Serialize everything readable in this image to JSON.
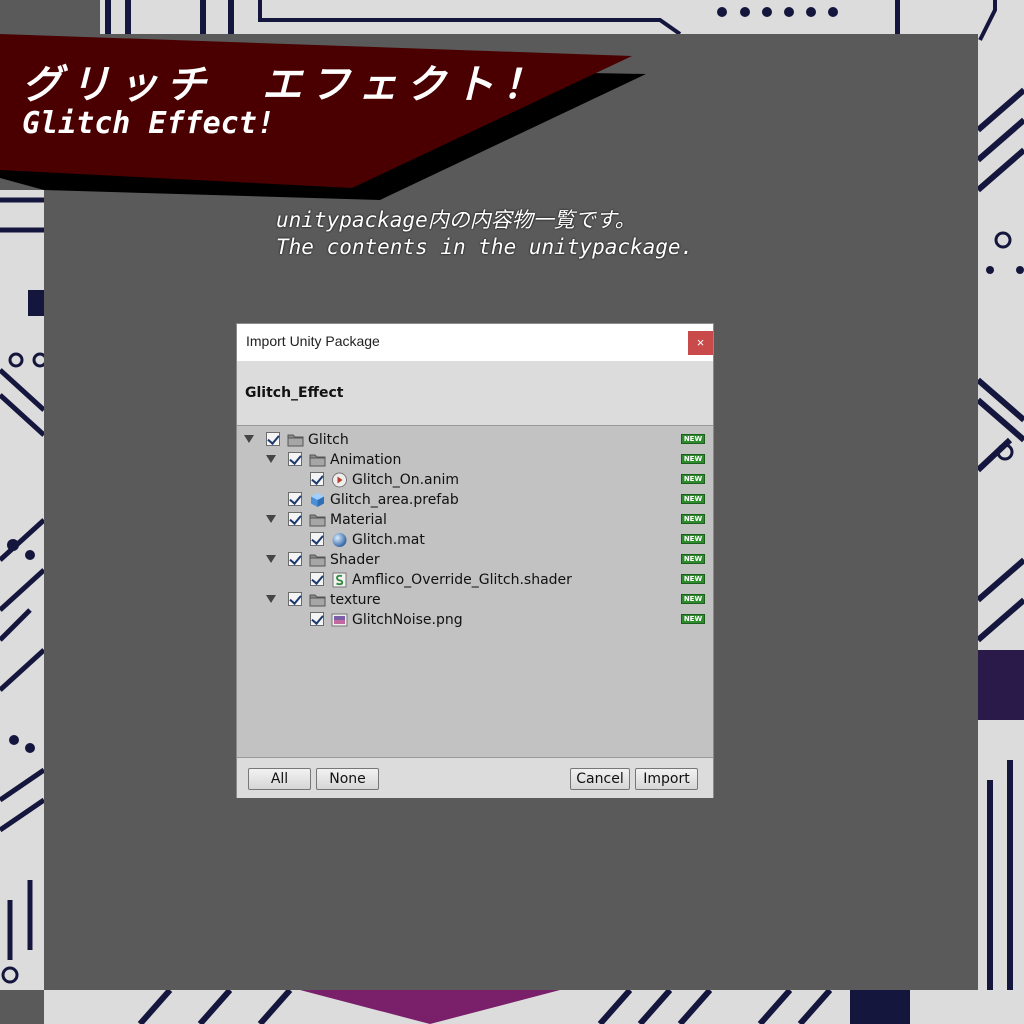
{
  "banner": {
    "title_jp": "グリッチ　エフェクト！",
    "title_en": "Glitch Effect!",
    "subtitle_jp": "unitypackage内の内容物一覧です。",
    "subtitle_en": "The contents in the unitypackage."
  },
  "dialog": {
    "window_title": "Import Unity Package",
    "close_label": "×",
    "package_name": "Glitch_Effect",
    "new_badge": "NEW",
    "items": [
      {
        "name": "Glitch",
        "type": "folder-icon",
        "checked": true,
        "expanded": true
      },
      {
        "name": "Animation",
        "type": "folder-icon",
        "checked": true,
        "expanded": true
      },
      {
        "name": "Glitch_On.anim",
        "type": "animation-icon",
        "checked": true
      },
      {
        "name": "Glitch_area.prefab",
        "type": "prefab-icon",
        "checked": true
      },
      {
        "name": "Material",
        "type": "folder-icon",
        "checked": true,
        "expanded": true
      },
      {
        "name": "Glitch.mat",
        "type": "material-icon",
        "checked": true
      },
      {
        "name": "Shader",
        "type": "folder-icon",
        "checked": true,
        "expanded": true
      },
      {
        "name": "Amflico_Override_Glitch.shader",
        "type": "shader-icon",
        "checked": true
      },
      {
        "name": "texture",
        "type": "folder-icon",
        "checked": true,
        "expanded": true
      },
      {
        "name": "GlitchNoise.png",
        "type": "texture-icon",
        "checked": true
      }
    ],
    "buttons": {
      "all": "All",
      "none": "None",
      "cancel": "Cancel",
      "import": "Import"
    }
  },
  "colors": {
    "banner_red": "#4a0000",
    "background": "#5a5a5a",
    "circuit_navy": "#14143c",
    "new_badge_green": "#2d8a2d",
    "close_red": "#c84a4a"
  }
}
